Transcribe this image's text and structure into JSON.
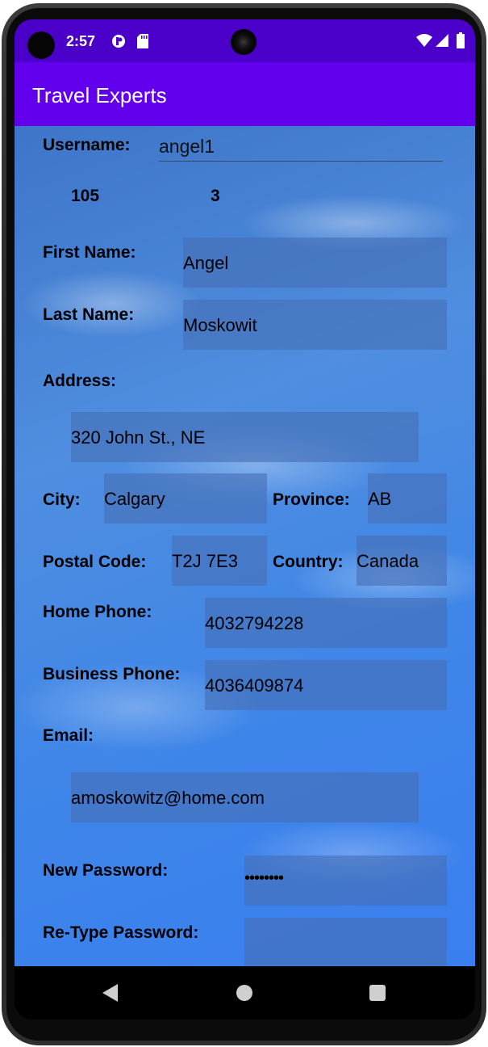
{
  "status_bar": {
    "time": "2:57",
    "icons": [
      "camera-cutout",
      "notification-app-icon",
      "sd-card-icon",
      "wifi-icon",
      "signal-icon",
      "battery-icon"
    ]
  },
  "app_bar": {
    "title": "Travel Experts"
  },
  "form": {
    "username": {
      "label": "Username:",
      "value": "angel1"
    },
    "customer_id": "105",
    "agent_id": "3",
    "first_name": {
      "label": "First Name:",
      "value": "Angel"
    },
    "last_name": {
      "label": "Last Name:",
      "value": "Moskowit"
    },
    "address": {
      "label": "Address:",
      "value": "320 John St., NE"
    },
    "city": {
      "label": "City:",
      "value": "Calgary"
    },
    "province": {
      "label": "Province:",
      "value": "AB"
    },
    "postal_code": {
      "label": "Postal Code:",
      "value": "T2J 7E3"
    },
    "country": {
      "label": "Country:",
      "value": "Canada"
    },
    "home_phone": {
      "label": "Home Phone:",
      "value": "4032794228"
    },
    "business_phone": {
      "label": "Business Phone:",
      "value": "4036409874"
    },
    "email": {
      "label": "Email:",
      "value": "amoskowitz@home.com"
    },
    "new_password": {
      "label": "New Password:",
      "value": "••••••••"
    },
    "retype_password": {
      "label": "Re-Type Password:",
      "value": ""
    }
  },
  "nav_bar": {
    "icons": [
      "back-icon",
      "home-icon",
      "recents-icon"
    ]
  },
  "colors": {
    "status_bar": "#4a00c8",
    "app_bar": "#6200ee",
    "input_fill": "#466eb4"
  }
}
